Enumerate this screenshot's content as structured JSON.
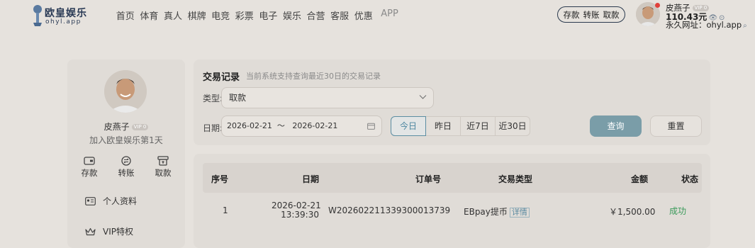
{
  "brand": {
    "name": "欧皇娱乐",
    "sub": "ohyl.app"
  },
  "nav": [
    "首页",
    "体育",
    "真人",
    "棋牌",
    "电竞",
    "彩票",
    "电子",
    "娱乐",
    "合营",
    "客服",
    "优惠",
    "APP"
  ],
  "quick_actions": [
    "存款",
    "转账",
    "取款"
  ],
  "user": {
    "name": "皮燕子",
    "vip": "VIP 0",
    "balance": "110.43元",
    "url_label": "永久网址：ohyl.app",
    "join_text": "加入欧皇娱乐第1天"
  },
  "sidebar": {
    "actions": [
      {
        "label": "存款",
        "icon": "wallet-icon"
      },
      {
        "label": "转账",
        "icon": "transfer-icon"
      },
      {
        "label": "取款",
        "icon": "withdraw-icon"
      }
    ],
    "menu": [
      {
        "label": "个人资料",
        "icon": "id-card-icon"
      },
      {
        "label": "VIP特权",
        "icon": "crown-icon"
      }
    ]
  },
  "filter": {
    "title": "交易记录",
    "subtitle": "当前系统支持查询最近30日的交易记录",
    "type_label": "类型:",
    "type_value": "取款",
    "date_label": "日期:",
    "date_range": "2026-02-21  ～   2026-02-21",
    "ranges": [
      "今日",
      "昨日",
      "近7日",
      "近30日"
    ],
    "active_range": "今日",
    "query_label": "查询",
    "reset_label": "重置"
  },
  "table": {
    "columns": [
      "序号",
      "日期",
      "订单号",
      "交易类型",
      "金额",
      "状态"
    ],
    "rows": [
      {
        "index": "1",
        "date_line1": "2026-02-21",
        "date_line2": "13:39:30",
        "order": "W20260221133930001373​9",
        "type": "EBpay提币",
        "detail": "详情",
        "amount": "￥1,500.00",
        "status": "成功"
      }
    ]
  },
  "colors": {
    "accent": "#7a9da8",
    "success": "#3a9a5a",
    "bg": "#e6e2dd",
    "panel": "#e0dcd7"
  }
}
